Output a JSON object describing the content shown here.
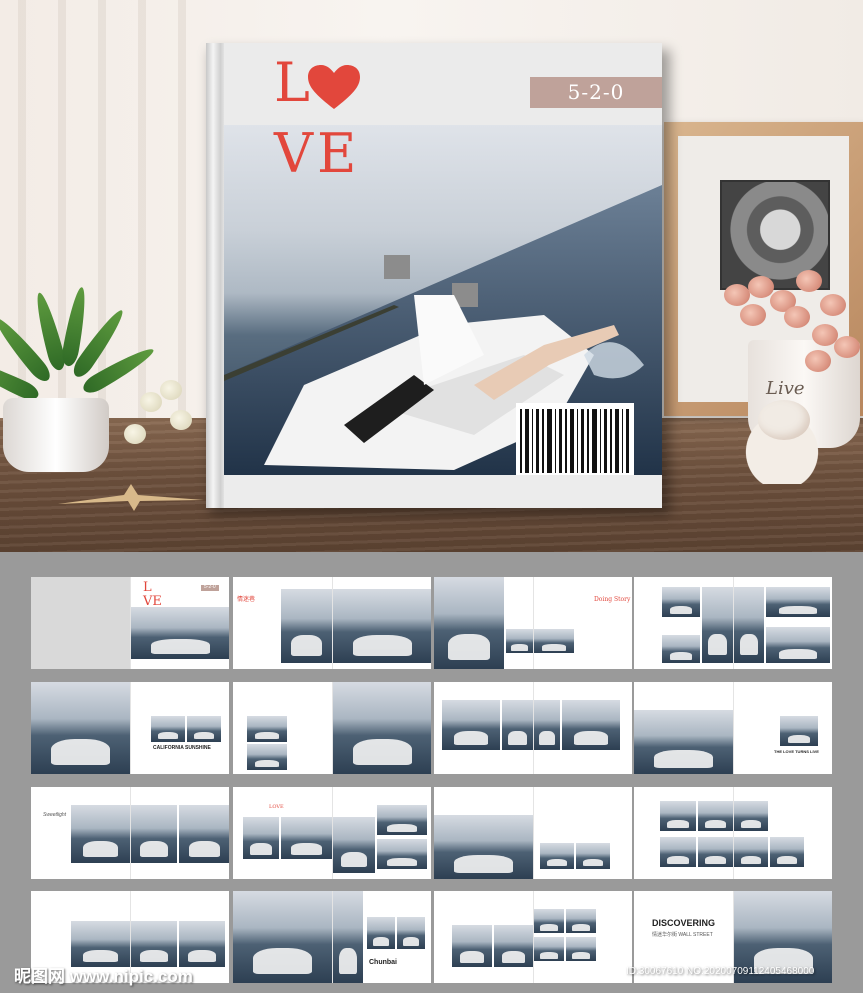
{
  "cover": {
    "title_l": "L",
    "title_ve": "VE",
    "tag": "5-2-0"
  },
  "frame": {
    "caption": ""
  },
  "vase": {
    "text": "Live"
  },
  "grid": {
    "cover_mini_l": "L",
    "cover_mini_ve": "VE",
    "cover_mini_tag": "5-2-0",
    "spread2_title": "情迷巷",
    "spread3_title": "Doing Story",
    "spread6_title": "CALIFORNIA SUNSHINE",
    "spread8_title": "THE LOVE TURNS LIVE",
    "spread9_title": "Sweetlight",
    "spread10_title": "LOVE",
    "spread13_title": "DISCOVERING",
    "spread13_sub": "情迷华尔街 WALL STREET",
    "spread14_title": "Chunbai"
  },
  "watermark": {
    "left": "昵图网 www.nipic.com",
    "right": "ID:30067610 NO:20200709112405468000"
  }
}
